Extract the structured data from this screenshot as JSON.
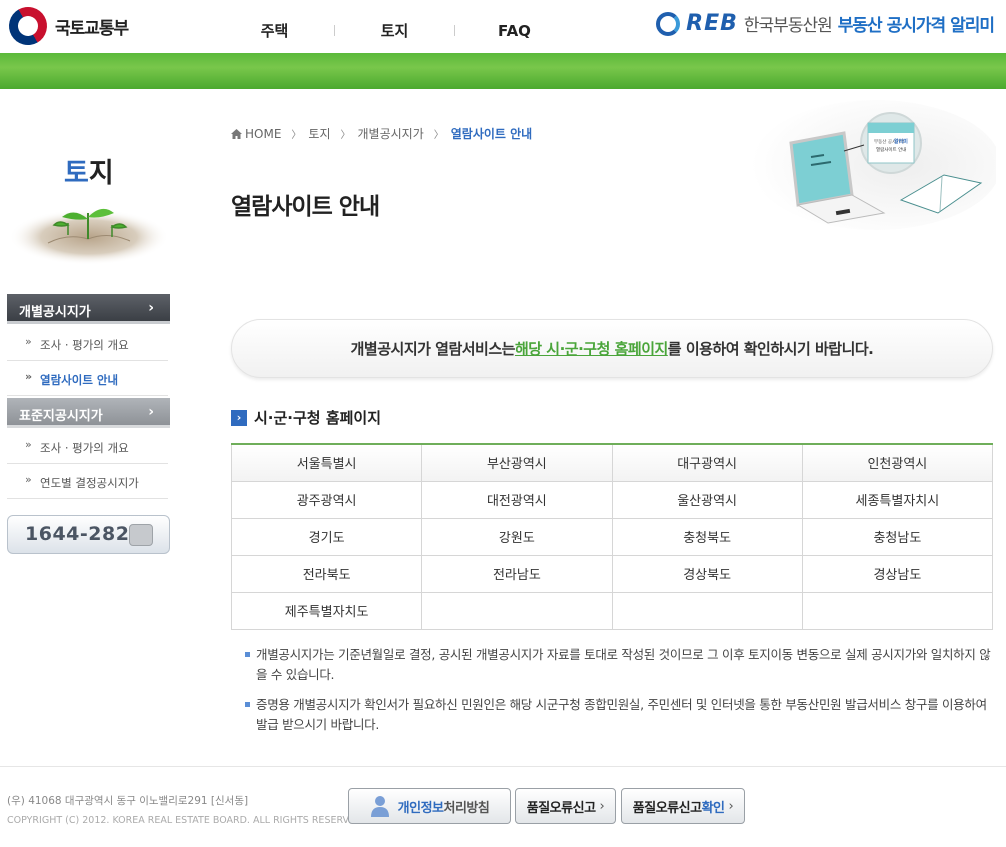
{
  "header": {
    "ministry_name": "국토교통부",
    "nav": [
      "주택",
      "토지",
      "FAQ"
    ],
    "brand_logo": "REB",
    "brand_org": "한국부동산원",
    "brand_service_prefix": "부동산 공시가격",
    "brand_service_suffix": "알리미"
  },
  "sidebar": {
    "title_first": "토",
    "title_rest": "지",
    "menu1": {
      "label": "개별공시지가",
      "items": [
        "조사 · 평가의 개요",
        "열람사이트 안내"
      ]
    },
    "menu2": {
      "label": "표준지공시지가",
      "items": [
        "조사 · 평가의 개요",
        "연도별 결정공시지가"
      ]
    },
    "phone": "1644-2828"
  },
  "breadcrumb": {
    "home": "HOME",
    "items": [
      "토지",
      "개별공시지가"
    ],
    "current": "열람사이트 안내"
  },
  "page_title": "열람사이트 안내",
  "illustration": {
    "screen_line1": "부동산 공시가격",
    "screen_line2": "알리미",
    "screen_line3": "열람사이트 안내"
  },
  "notice": {
    "before": "개별공시지가 열람서비스는 ",
    "highlight": "해당 시·군·구청 홈페이지",
    "after": "를 이용하여 확인하시기 바랍니다."
  },
  "section_title": "시·군·구청 홈페이지",
  "regions": [
    [
      "서울특별시",
      "부산광역시",
      "대구광역시",
      "인천광역시"
    ],
    [
      "광주광역시",
      "대전광역시",
      "울산광역시",
      "세종특별자치시"
    ],
    [
      "경기도",
      "강원도",
      "충청북도",
      "충청남도"
    ],
    [
      "전라북도",
      "전라남도",
      "경상북도",
      "경상남도"
    ],
    [
      "제주특별자치도",
      "",
      "",
      ""
    ]
  ],
  "notes": [
    "개별공시지가는 기준년월일로 결정, 공시된 개별공시지가 자료를 토대로 작성된 것이므로 그 이후 토지이동 변동으로 실제 공시지가와 일치하지 않을 수 있습니다.",
    "증명용 개별공시지가 확인서가 필요하신 민원인은 해당 시군구청 종합민원실, 주민센터 및 인터넷을 통한 부동산민원 발급서비스 창구를 이용하여 발급 받으시기 바랍니다."
  ],
  "footer": {
    "address": "(우) 41068   대구광역시 동구 이노밸리로291 [신서동]",
    "copyright": "COPYRIGHT (C) 2012. KOREA REAL ESTATE BOARD. ALL RIGHTS RESERVED.",
    "privacy_blue": "개인정보",
    "privacy_rest": "처리방침",
    "report": "품질오류신고",
    "check_prefix": "품질오류신고",
    "check_blue": "확인"
  },
  "colors": {
    "green_bar": "#5bb93a",
    "accent_blue": "#2f6bbf",
    "highlight_green": "#4aa53a"
  }
}
